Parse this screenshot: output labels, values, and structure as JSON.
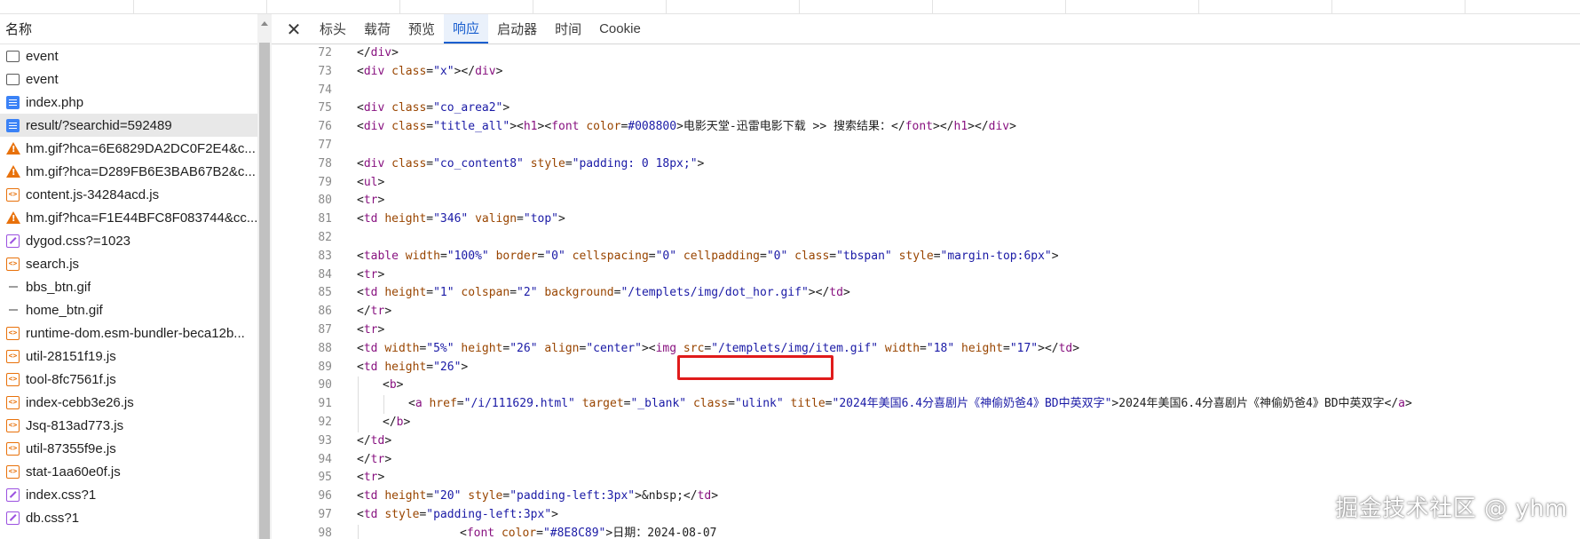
{
  "left_panel": {
    "header": "名称",
    "requests": [
      {
        "icon": "checkbox-icon",
        "name": "event"
      },
      {
        "icon": "checkbox-icon",
        "name": "event"
      },
      {
        "icon": "document-icon",
        "name": "index.php"
      },
      {
        "icon": "document-icon",
        "name": "result/?searchid=592489",
        "selected": true
      },
      {
        "icon": "warning-icon",
        "name": "hm.gif?hca=6E6829DA2DC0F2E4&c..."
      },
      {
        "icon": "warning-icon",
        "name": "hm.gif?hca=D289FB6E3BAB67B2&c..."
      },
      {
        "icon": "script-icon",
        "name": "content.js-34284acd.js"
      },
      {
        "icon": "warning-icon",
        "name": "hm.gif?hca=F1E44BFC8F083744&cc..."
      },
      {
        "icon": "stylesheet-icon",
        "name": "dygod.css?=1023"
      },
      {
        "icon": "script-icon",
        "name": "search.js"
      },
      {
        "icon": "image-icon",
        "name": "bbs_btn.gif"
      },
      {
        "icon": "image-icon",
        "name": "home_btn.gif"
      },
      {
        "icon": "script-icon",
        "name": "runtime-dom.esm-bundler-beca12b..."
      },
      {
        "icon": "script-icon",
        "name": "util-28151f19.js"
      },
      {
        "icon": "script-icon",
        "name": "tool-8fc7561f.js"
      },
      {
        "icon": "script-icon",
        "name": "index-cebb3e26.js"
      },
      {
        "icon": "script-icon",
        "name": "Jsq-813ad773.js"
      },
      {
        "icon": "script-icon",
        "name": "util-87355f9e.js"
      },
      {
        "icon": "script-icon",
        "name": "stat-1aa60e0f.js"
      },
      {
        "icon": "stylesheet-icon",
        "name": "index.css?1"
      },
      {
        "icon": "stylesheet-icon",
        "name": "db.css?1"
      }
    ]
  },
  "tabs": [
    {
      "label": "标头",
      "active": false
    },
    {
      "label": "载荷",
      "active": false
    },
    {
      "label": "预览",
      "active": false
    },
    {
      "label": "响应",
      "active": true
    },
    {
      "label": "启动器",
      "active": false
    },
    {
      "label": "时间",
      "active": false
    },
    {
      "label": "Cookie",
      "active": false
    }
  ],
  "close_glyph": "✕",
  "code_lines": [
    {
      "n": "72",
      "indent": 0,
      "tokens": [
        [
          "p",
          "</"
        ],
        [
          "t",
          "div"
        ],
        [
          "p",
          ">"
        ]
      ]
    },
    {
      "n": "73",
      "indent": 0,
      "tokens": [
        [
          "p",
          "<"
        ],
        [
          "t",
          "div"
        ],
        [
          "p",
          " "
        ],
        [
          "a",
          "class"
        ],
        [
          "p",
          "="
        ],
        [
          "v",
          "\"x\""
        ],
        [
          "p",
          "></"
        ],
        [
          "t",
          "div"
        ],
        [
          "p",
          ">"
        ]
      ]
    },
    {
      "n": "74",
      "indent": 0,
      "tokens": []
    },
    {
      "n": "75",
      "indent": 0,
      "tokens": [
        [
          "p",
          "<"
        ],
        [
          "t",
          "div"
        ],
        [
          "p",
          " "
        ],
        [
          "a",
          "class"
        ],
        [
          "p",
          "="
        ],
        [
          "v",
          "\"co_area2\""
        ],
        [
          "p",
          ">"
        ]
      ]
    },
    {
      "n": "76",
      "indent": 0,
      "tokens": [
        [
          "p",
          "<"
        ],
        [
          "t",
          "div"
        ],
        [
          "p",
          " "
        ],
        [
          "a",
          "class"
        ],
        [
          "p",
          "="
        ],
        [
          "v",
          "\"title_all\""
        ],
        [
          "p",
          "><"
        ],
        [
          "t",
          "h1"
        ],
        [
          "p",
          "><"
        ],
        [
          "t",
          "font"
        ],
        [
          "p",
          " "
        ],
        [
          "a",
          "color"
        ],
        [
          "p",
          "="
        ],
        [
          "v",
          "#008800"
        ],
        [
          "p",
          ">电影天堂-迅雷电影下载 >> 搜索结果：</"
        ],
        [
          "t",
          "font"
        ],
        [
          "p",
          "></"
        ],
        [
          "t",
          "h1"
        ],
        [
          "p",
          "></"
        ],
        [
          "t",
          "div"
        ],
        [
          "p",
          ">"
        ]
      ]
    },
    {
      "n": "77",
      "indent": 0,
      "tokens": []
    },
    {
      "n": "78",
      "indent": 0,
      "tokens": [
        [
          "p",
          "<"
        ],
        [
          "t",
          "div"
        ],
        [
          "p",
          " "
        ],
        [
          "a",
          "class"
        ],
        [
          "p",
          "="
        ],
        [
          "v",
          "\"co_content8\""
        ],
        [
          "p",
          " "
        ],
        [
          "a",
          "style"
        ],
        [
          "p",
          "="
        ],
        [
          "v",
          "\"padding: 0 18px;\""
        ],
        [
          "p",
          ">"
        ]
      ]
    },
    {
      "n": "79",
      "indent": 0,
      "tokens": [
        [
          "p",
          "<"
        ],
        [
          "t",
          "ul"
        ],
        [
          "p",
          ">"
        ]
      ]
    },
    {
      "n": "80",
      "indent": 0,
      "tokens": [
        [
          "p",
          "<"
        ],
        [
          "t",
          "tr"
        ],
        [
          "p",
          ">"
        ]
      ]
    },
    {
      "n": "81",
      "indent": 0,
      "tokens": [
        [
          "p",
          "<"
        ],
        [
          "t",
          "td"
        ],
        [
          "p",
          " "
        ],
        [
          "a",
          "height"
        ],
        [
          "p",
          "="
        ],
        [
          "v",
          "\"346\""
        ],
        [
          "p",
          " "
        ],
        [
          "a",
          "valign"
        ],
        [
          "p",
          "="
        ],
        [
          "v",
          "\"top\""
        ],
        [
          "p",
          ">"
        ]
      ]
    },
    {
      "n": "82",
      "indent": 0,
      "tokens": []
    },
    {
      "n": "83",
      "indent": 0,
      "tokens": [
        [
          "p",
          "<"
        ],
        [
          "t",
          "table"
        ],
        [
          "p",
          " "
        ],
        [
          "a",
          "width"
        ],
        [
          "p",
          "="
        ],
        [
          "v",
          "\"100%\""
        ],
        [
          "p",
          " "
        ],
        [
          "a",
          "border"
        ],
        [
          "p",
          "="
        ],
        [
          "v",
          "\"0\""
        ],
        [
          "p",
          " "
        ],
        [
          "a",
          "cellspacing"
        ],
        [
          "p",
          "="
        ],
        [
          "v",
          "\"0\""
        ],
        [
          "p",
          " "
        ],
        [
          "a",
          "cellpadding"
        ],
        [
          "p",
          "="
        ],
        [
          "v",
          "\"0\""
        ],
        [
          "p",
          " "
        ],
        [
          "a",
          "class"
        ],
        [
          "p",
          "="
        ],
        [
          "v",
          "\"tbspan\""
        ],
        [
          "p",
          " "
        ],
        [
          "a",
          "style"
        ],
        [
          "p",
          "="
        ],
        [
          "v",
          "\"margin-top:6px\""
        ],
        [
          "p",
          ">"
        ]
      ]
    },
    {
      "n": "84",
      "indent": 0,
      "tokens": [
        [
          "p",
          "<"
        ],
        [
          "t",
          "tr"
        ],
        [
          "p",
          ">"
        ]
      ]
    },
    {
      "n": "85",
      "indent": 0,
      "tokens": [
        [
          "p",
          "<"
        ],
        [
          "t",
          "td"
        ],
        [
          "p",
          " "
        ],
        [
          "a",
          "height"
        ],
        [
          "p",
          "="
        ],
        [
          "v",
          "\"1\""
        ],
        [
          "p",
          " "
        ],
        [
          "a",
          "colspan"
        ],
        [
          "p",
          "="
        ],
        [
          "v",
          "\"2\""
        ],
        [
          "p",
          " "
        ],
        [
          "a",
          "background"
        ],
        [
          "p",
          "="
        ],
        [
          "v",
          "\"/templets/img/dot_hor.gif\""
        ],
        [
          "p",
          "></"
        ],
        [
          "t",
          "td"
        ],
        [
          "p",
          ">"
        ]
      ]
    },
    {
      "n": "86",
      "indent": 0,
      "tokens": [
        [
          "p",
          "</"
        ],
        [
          "t",
          "tr"
        ],
        [
          "p",
          ">"
        ]
      ]
    },
    {
      "n": "87",
      "indent": 0,
      "tokens": [
        [
          "p",
          "<"
        ],
        [
          "t",
          "tr"
        ],
        [
          "p",
          ">"
        ]
      ]
    },
    {
      "n": "88",
      "indent": 0,
      "tokens": [
        [
          "p",
          "<"
        ],
        [
          "t",
          "td"
        ],
        [
          "p",
          " "
        ],
        [
          "a",
          "width"
        ],
        [
          "p",
          "="
        ],
        [
          "v",
          "\"5%\""
        ],
        [
          "p",
          " "
        ],
        [
          "a",
          "height"
        ],
        [
          "p",
          "="
        ],
        [
          "v",
          "\"26\""
        ],
        [
          "p",
          " "
        ],
        [
          "a",
          "align"
        ],
        [
          "p",
          "="
        ],
        [
          "v",
          "\"center\""
        ],
        [
          "p",
          "><"
        ],
        [
          "t",
          "img"
        ],
        [
          "p",
          " "
        ],
        [
          "a",
          "src"
        ],
        [
          "p",
          "="
        ],
        [
          "v",
          "\"/templets/img/item.gif\""
        ],
        [
          "p",
          " "
        ],
        [
          "a",
          "width"
        ],
        [
          "p",
          "="
        ],
        [
          "v",
          "\"18\""
        ],
        [
          "p",
          " "
        ],
        [
          "a",
          "height"
        ],
        [
          "p",
          "="
        ],
        [
          "v",
          "\"17\""
        ],
        [
          "p",
          "></"
        ],
        [
          "t",
          "td"
        ],
        [
          "p",
          ">"
        ]
      ]
    },
    {
      "n": "89",
      "indent": 0,
      "tokens": [
        [
          "p",
          "<"
        ],
        [
          "t",
          "td"
        ],
        [
          "p",
          " "
        ],
        [
          "a",
          "height"
        ],
        [
          "p",
          "="
        ],
        [
          "v",
          "\"26\""
        ],
        [
          "p",
          ">"
        ]
      ]
    },
    {
      "n": "90",
      "indent": 1,
      "tokens": [
        [
          "p",
          "<"
        ],
        [
          "t",
          "b"
        ],
        [
          "p",
          ">"
        ]
      ]
    },
    {
      "n": "91",
      "indent": 2,
      "tokens": [
        [
          "p",
          "<"
        ],
        [
          "t",
          "a"
        ],
        [
          "p",
          " "
        ],
        [
          "a",
          "href"
        ],
        [
          "p",
          "="
        ],
        [
          "v",
          "\"/i/111629.html\""
        ],
        [
          "p",
          " "
        ],
        [
          "a",
          "target"
        ],
        [
          "p",
          "="
        ],
        [
          "v",
          "\"_blank\""
        ],
        [
          "p",
          " "
        ],
        [
          "a",
          "class"
        ],
        [
          "p",
          "="
        ],
        [
          "v",
          "\"ulink\""
        ],
        [
          "p",
          " "
        ],
        [
          "a",
          "title"
        ],
        [
          "p",
          "="
        ],
        [
          "v",
          "\"2024年美国6.4分喜剧片《神偷奶爸4》BD中英双字\""
        ],
        [
          "p",
          ">2024年美国6.4分喜剧片《神偷奶爸4》BD中英双字</"
        ],
        [
          "t",
          "a"
        ],
        [
          "p",
          ">"
        ]
      ]
    },
    {
      "n": "92",
      "indent": 1,
      "tokens": [
        [
          "p",
          "</"
        ],
        [
          "t",
          "b"
        ],
        [
          "p",
          ">"
        ]
      ]
    },
    {
      "n": "93",
      "indent": 0,
      "tokens": [
        [
          "p",
          "</"
        ],
        [
          "t",
          "td"
        ],
        [
          "p",
          ">"
        ]
      ]
    },
    {
      "n": "94",
      "indent": 0,
      "tokens": [
        [
          "p",
          "</"
        ],
        [
          "t",
          "tr"
        ],
        [
          "p",
          ">"
        ]
      ]
    },
    {
      "n": "95",
      "indent": 0,
      "tokens": [
        [
          "p",
          "<"
        ],
        [
          "t",
          "tr"
        ],
        [
          "p",
          ">"
        ]
      ]
    },
    {
      "n": "96",
      "indent": 0,
      "tokens": [
        [
          "p",
          "<"
        ],
        [
          "t",
          "td"
        ],
        [
          "p",
          " "
        ],
        [
          "a",
          "height"
        ],
        [
          "p",
          "="
        ],
        [
          "v",
          "\"20\""
        ],
        [
          "p",
          " "
        ],
        [
          "a",
          "style"
        ],
        [
          "p",
          "="
        ],
        [
          "v",
          "\"padding-left:3px\""
        ],
        [
          "p",
          ">&nbsp;</"
        ],
        [
          "t",
          "td"
        ],
        [
          "p",
          ">"
        ]
      ]
    },
    {
      "n": "97",
      "indent": 0,
      "tokens": [
        [
          "p",
          "<"
        ],
        [
          "t",
          "td"
        ],
        [
          "p",
          " "
        ],
        [
          "a",
          "style"
        ],
        [
          "p",
          "="
        ],
        [
          "v",
          "\"padding-left:3px\""
        ],
        [
          "p",
          ">"
        ]
      ]
    },
    {
      "n": "98",
      "indent": 4,
      "tokens": [
        [
          "p",
          "<"
        ],
        [
          "t",
          "font"
        ],
        [
          "p",
          " "
        ],
        [
          "a",
          "color"
        ],
        [
          "p",
          "="
        ],
        [
          "v",
          "\"#8E8C89\""
        ],
        [
          "p",
          ">日期：2024-08-07"
        ]
      ]
    }
  ],
  "watermark": "掘金技术社区 @ yhm"
}
